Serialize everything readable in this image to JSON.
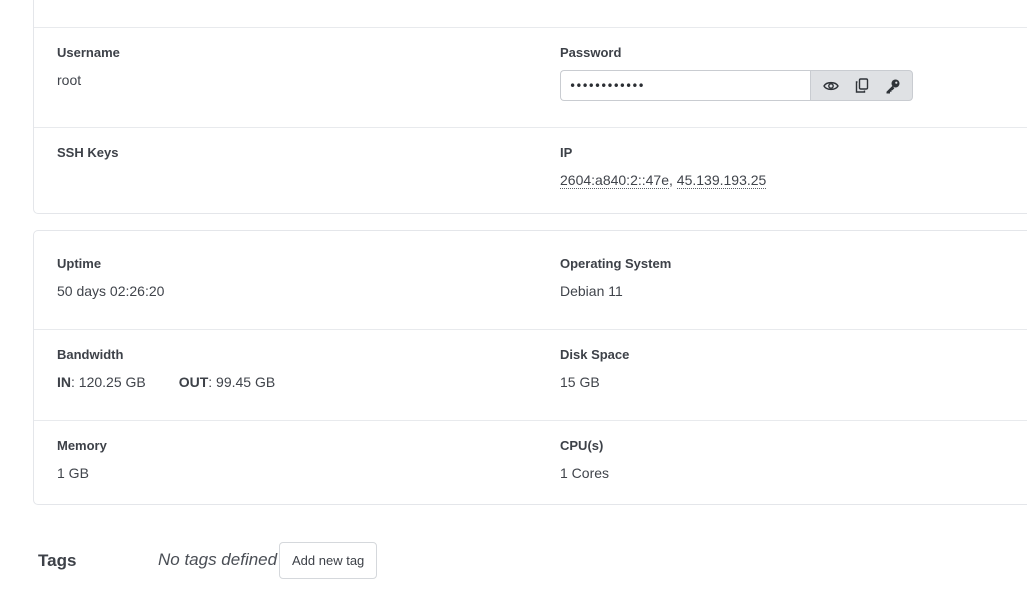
{
  "access": {
    "username_label": "Username",
    "username_value": "root",
    "password_label": "Password",
    "password_masked": "••••••••••••",
    "ssh_label": "SSH Keys",
    "ip_label": "IP",
    "ip_v6": "2604:a840:2::47e",
    "ip_separator": ", ",
    "ip_v4": "45.139.193.25"
  },
  "stats": {
    "uptime_label": "Uptime",
    "uptime_value": "50 days 02:26:20",
    "os_label": "Operating System",
    "os_value": "Debian 11",
    "bandwidth_label": "Bandwidth",
    "bw_in_label": "IN",
    "bw_in_value": ": 120.25 GB",
    "bw_out_label": "OUT",
    "bw_out_value": ": 99.45 GB",
    "disk_label": "Disk Space",
    "disk_value": "15 GB",
    "memory_label": "Memory",
    "memory_value": "1 GB",
    "cpu_label": "CPU(s)",
    "cpu_value": "1 Cores"
  },
  "tags": {
    "title": "Tags",
    "empty_text": "No tags defined",
    "add_button": "Add new tag"
  },
  "icons": {
    "show_password": "eye-icon",
    "copy_password": "copy-icon",
    "reset_password": "key-icon"
  }
}
